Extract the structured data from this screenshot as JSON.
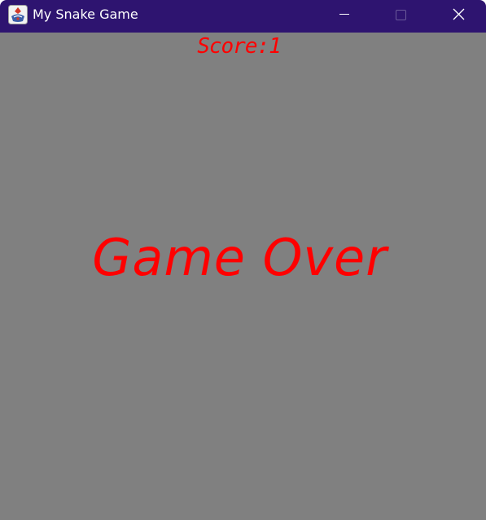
{
  "window": {
    "title": "My Snake Game",
    "app_icon": "java-coffee-icon",
    "controls": [
      "minimize-icon",
      "maximize-icon",
      "close-icon"
    ]
  },
  "game": {
    "score_label": "Score:1",
    "message": "Game Over"
  },
  "colors": {
    "titlebar": "#2e1470",
    "background": "#808080",
    "text": "#ff0000"
  }
}
